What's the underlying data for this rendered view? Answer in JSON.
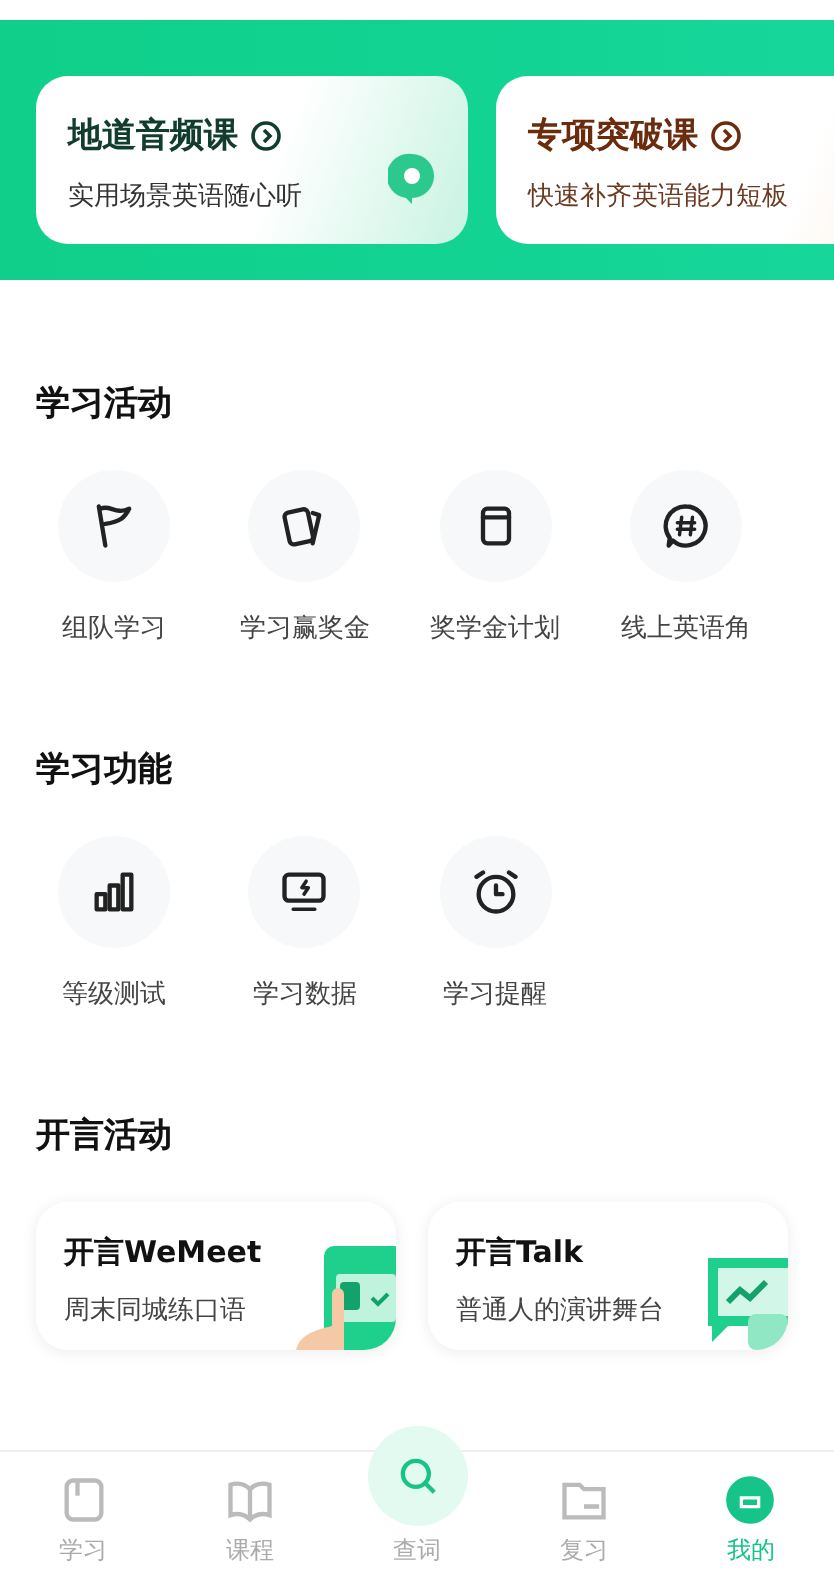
{
  "banner_cards": [
    {
      "title": "地道音频课",
      "subtitle": "实用场景英语随心听"
    },
    {
      "title": "专项突破课",
      "subtitle": "快速补齐英语能力短板"
    }
  ],
  "sections": [
    {
      "title": "学习活动",
      "items": [
        {
          "label": "组队学习"
        },
        {
          "label": "学习赢奖金"
        },
        {
          "label": "奖学金计划"
        },
        {
          "label": "线上英语角"
        }
      ]
    },
    {
      "title": "学习功能",
      "items": [
        {
          "label": "等级测试"
        },
        {
          "label": "学习数据"
        },
        {
          "label": "学习提醒"
        }
      ]
    }
  ],
  "events": {
    "title": "开言活动",
    "cards": [
      {
        "title": "开言WeMeet",
        "subtitle": "周末同城练口语"
      },
      {
        "title": "开言Talk",
        "subtitle": "普通人的演讲舞台"
      }
    ]
  },
  "tab_bar": [
    {
      "label": "学习",
      "kind": "normal",
      "selected": false
    },
    {
      "label": "课程",
      "kind": "normal",
      "selected": false
    },
    {
      "label": "查词",
      "kind": "center",
      "selected": false
    },
    {
      "label": "复习",
      "kind": "normal",
      "selected": false
    },
    {
      "label": "我的",
      "kind": "normal",
      "selected": true
    }
  ]
}
